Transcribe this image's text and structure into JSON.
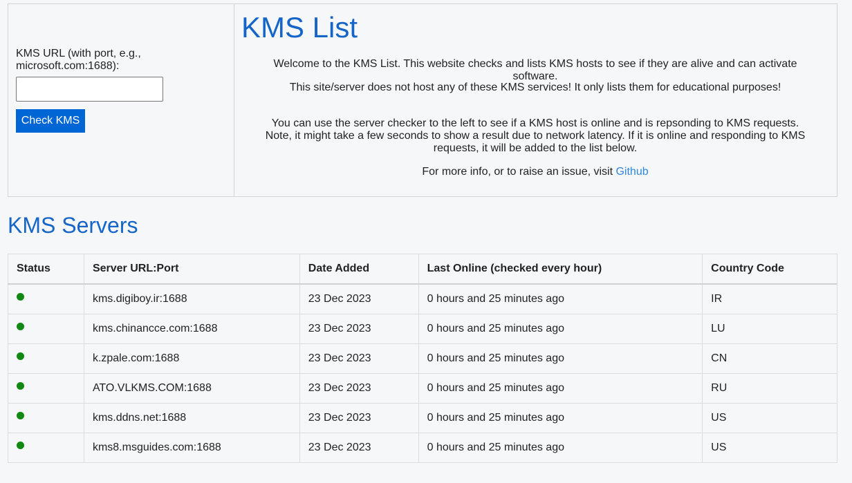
{
  "checker": {
    "label": "KMS URL (with port, e.g., microsoft.com:1688):",
    "input_value": "",
    "button_label": "Check KMS"
  },
  "info": {
    "title": "KMS List",
    "paragraph1": "Welcome to the KMS List. This website checks and lists KMS hosts to see if they are alive and can activate software.",
    "paragraph2": "This site/server does not host any of these KMS services! It only lists them for educational purposes!",
    "paragraph3": "You can use the server checker to the left to see if a KMS host is online and is repsonding to KMS requests. Note, it might take a few seconds to show a result due to network latency. If it is online and responding to KMS requests, it will be added to the list below.",
    "paragraph4_prefix": "For more info, or to raise an issue, visit ",
    "github_link": "Github"
  },
  "servers": {
    "title": "KMS Servers",
    "headers": {
      "status": "Status",
      "url": "Server URL:Port",
      "date": "Date Added",
      "last_online": "Last Online (checked every hour)",
      "country": "Country Code"
    },
    "status_color": "#118811",
    "rows": [
      {
        "url": "kms.digiboy.ir:1688",
        "date": "23 Dec 2023",
        "last_online": "0 hours and 25 minutes ago",
        "country": "IR"
      },
      {
        "url": "kms.chinancce.com:1688",
        "date": "23 Dec 2023",
        "last_online": "0 hours and 25 minutes ago",
        "country": "LU"
      },
      {
        "url": "k.zpale.com:1688",
        "date": "23 Dec 2023",
        "last_online": "0 hours and 25 minutes ago",
        "country": "CN"
      },
      {
        "url": "ATO.VLKMS.COM:1688",
        "date": "23 Dec 2023",
        "last_online": "0 hours and 25 minutes ago",
        "country": "RU"
      },
      {
        "url": "kms.ddns.net:1688",
        "date": "23 Dec 2023",
        "last_online": "0 hours and 25 minutes ago",
        "country": "US"
      },
      {
        "url": "kms8.msguides.com:1688",
        "date": "23 Dec 2023",
        "last_online": "0 hours and 25 minutes ago",
        "country": "US"
      }
    ]
  }
}
